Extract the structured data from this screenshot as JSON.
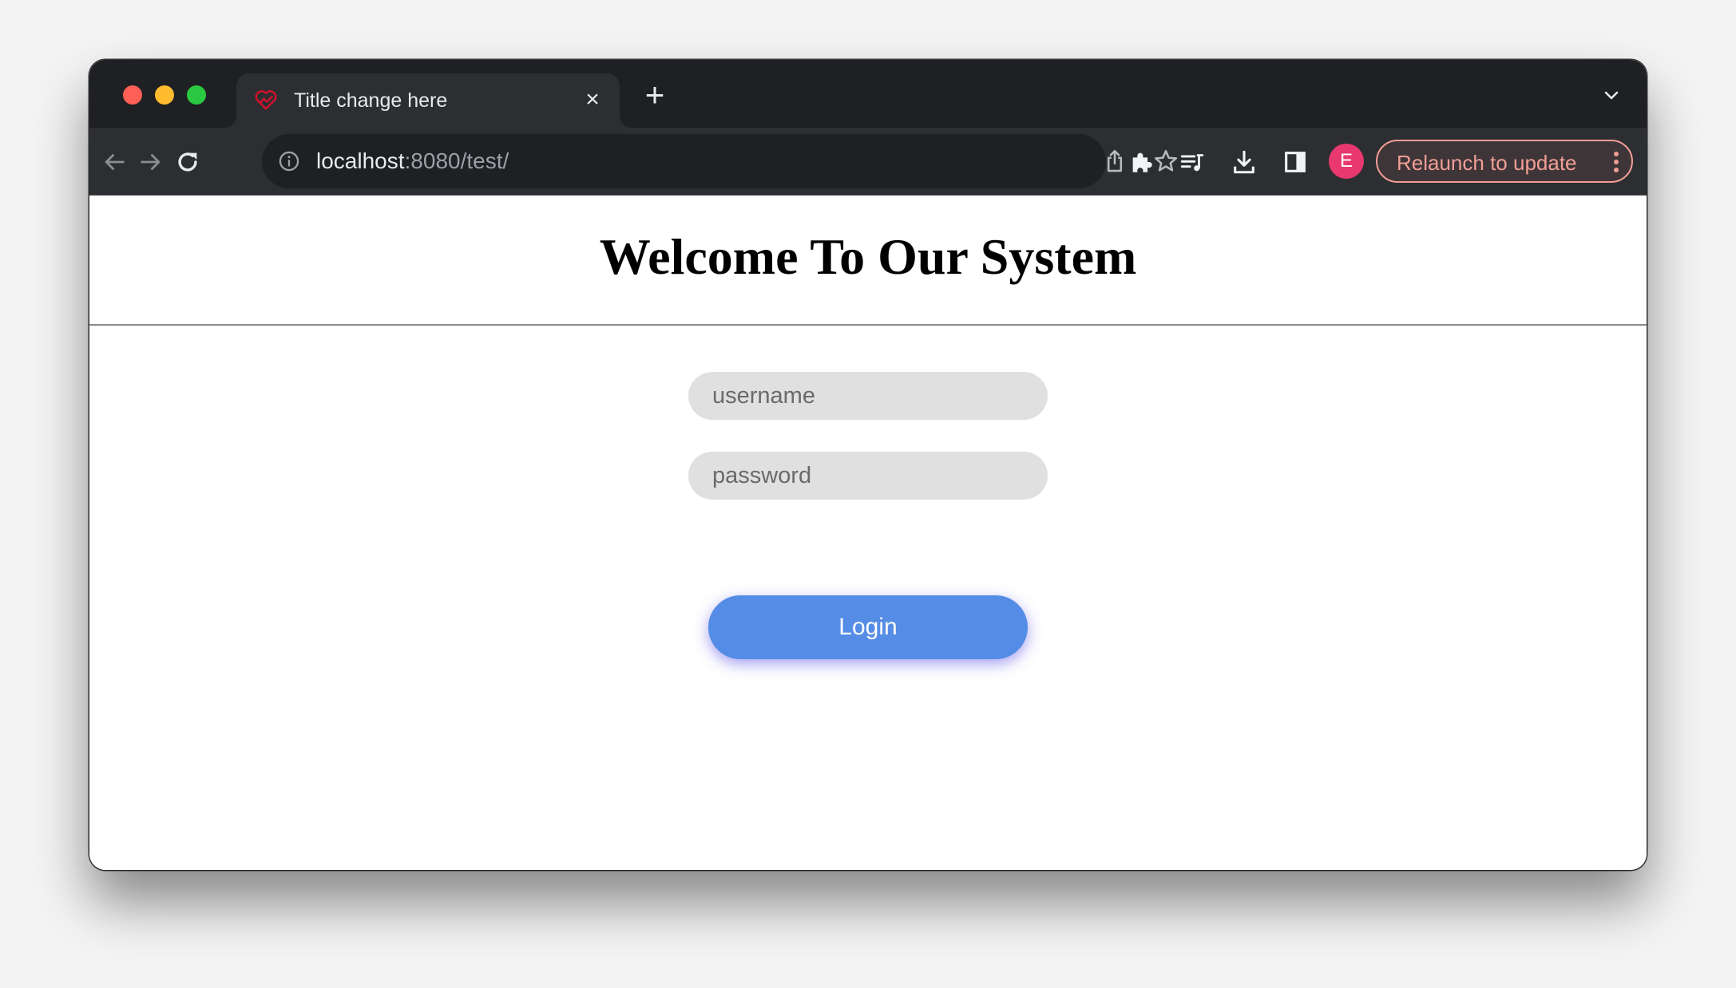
{
  "browser": {
    "tab": {
      "title": "Title change here",
      "favicon": "heart-pulse-icon",
      "close_label": "×"
    },
    "new_tab_label": "+",
    "address_bar": {
      "host": "localhost",
      "rest": ":8080/test/"
    },
    "profile_initial": "E",
    "relaunch_label": "Relaunch to update",
    "colors": {
      "tabstrip": "#1f2023",
      "toolbar": "#2d2e32",
      "avatar": "#e8386f",
      "relaunch": "#f19e96"
    }
  },
  "page": {
    "heading": "Welcome To Our System",
    "form": {
      "username_placeholder": "username",
      "password_placeholder": "password",
      "login_label": "Login"
    },
    "colors": {
      "login_button": "#558ce5",
      "input_bg": "#e0e0e0"
    }
  }
}
